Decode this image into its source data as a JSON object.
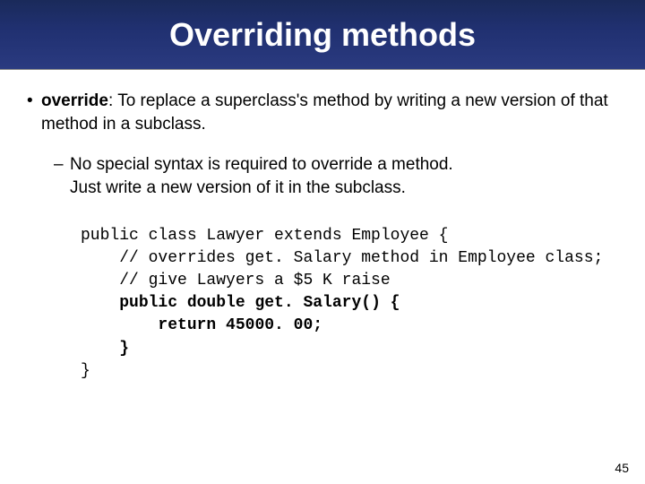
{
  "header": {
    "title": "Overriding methods"
  },
  "bullets": {
    "main": {
      "term": "override",
      "definition": ": To replace a superclass's method by writing a new version of that method in a subclass."
    },
    "sub": {
      "line1": "No special syntax is required to override a method.",
      "line2": "Just write a new version of it in the subclass."
    }
  },
  "code": {
    "l1": "public class Lawyer extends Employee {",
    "l2": "    // overrides get. Salary method in Employee class;",
    "l3": "    // give Lawyers a $5 K raise",
    "l4a": "    ",
    "l4b": "public double get. Salary() {",
    "l5a": "        ",
    "l5b": "return 45000. 00;",
    "l6a": "    ",
    "l6b": "}",
    "l7": "}"
  },
  "page_number": "45"
}
